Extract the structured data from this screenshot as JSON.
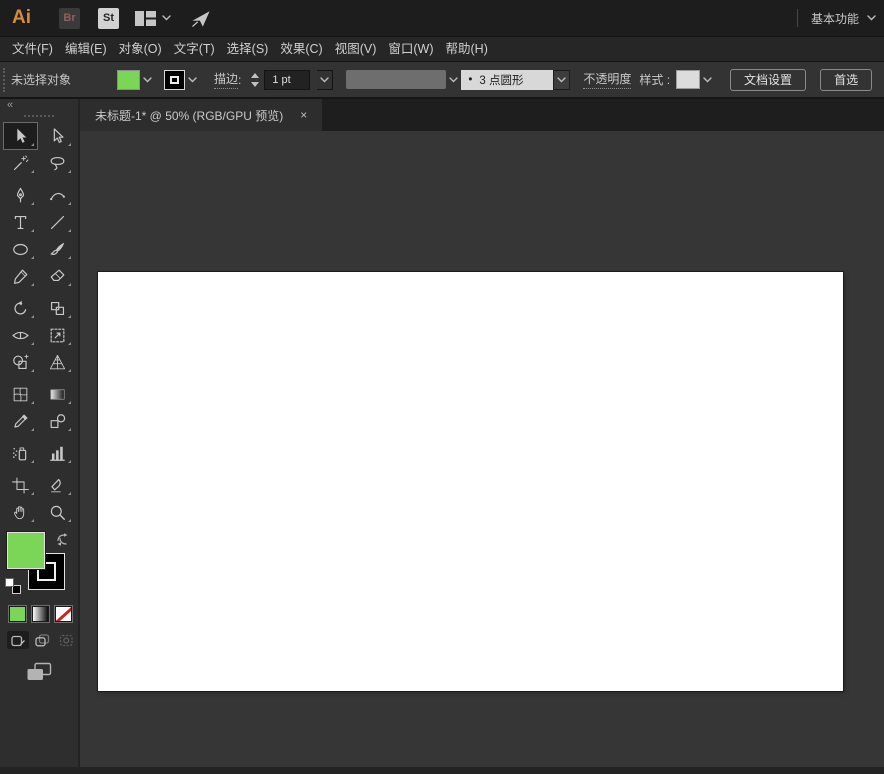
{
  "app_bar": {
    "logo_text": "Ai",
    "bridge_badge": "Br",
    "stock_badge": "St",
    "workspace_switcher": "基本功能"
  },
  "menu_bar": {
    "items": [
      "文件(F)",
      "编辑(E)",
      "对象(O)",
      "文字(T)",
      "选择(S)",
      "效果(C)",
      "视图(V)",
      "窗口(W)",
      "帮助(H)"
    ]
  },
  "control_bar": {
    "selection_status": "未选择对象",
    "stroke_label": "描边",
    "colon": ":",
    "stroke_weight_value": "1 pt",
    "brush_bullet": "•",
    "brush_name": "3 点圆形",
    "opacity_label": "不透明度",
    "style_label": "样式 :",
    "document_setup_button": "文档设置",
    "preferences_button": "首选",
    "fill_color": "#7bd556",
    "stroke_color": "#000000"
  },
  "tab_bar": {
    "active_tab_title": "未标题-1* @ 50% (RGB/GPU 预览)",
    "close_glyph": "×"
  },
  "toolbar": {
    "collapse_glyph": "«",
    "tools": [
      "selection",
      "direct-selection",
      "magic-wand",
      "lasso",
      "pen",
      "curvature",
      "type",
      "line-segment",
      "ellipse",
      "paintbrush",
      "shaper",
      "eraser",
      "rotate",
      "scale",
      "width",
      "free-transform",
      "shape-builder",
      "perspective-grid",
      "mesh",
      "gradient",
      "eyedropper",
      "blend",
      "symbol-sprayer",
      "column-graph",
      "artboard",
      "slice",
      "hand",
      "zoom"
    ],
    "fill_color": "#7bd556",
    "stroke_color": "#000000"
  },
  "colors": {
    "titlebar_bg": "#1d1d1d",
    "panel_bg": "#2e2e2e",
    "controlbar_bg": "#333333",
    "pasteboard_bg": "#363636",
    "artboard_bg": "#ffffff",
    "accent_green": "#7bd556"
  }
}
